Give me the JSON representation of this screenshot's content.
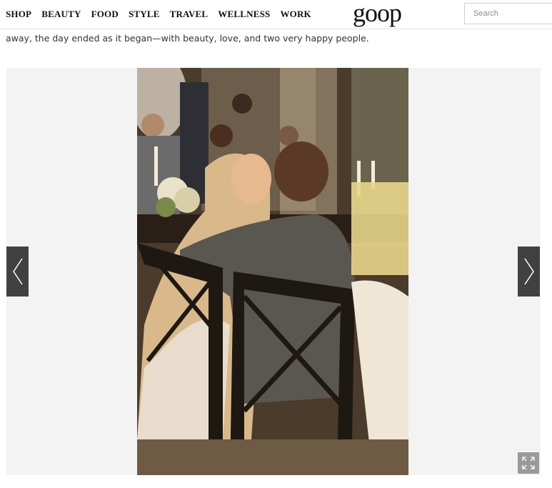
{
  "nav": {
    "items": [
      {
        "label": "SHOP"
      },
      {
        "label": "BEAUTY"
      },
      {
        "label": "FOOD"
      },
      {
        "label": "STYLE"
      },
      {
        "label": "TRAVEL"
      },
      {
        "label": "WELLNESS"
      },
      {
        "label": "WORK"
      }
    ],
    "logo": "goop",
    "search_placeholder": "Search"
  },
  "article": {
    "caption": "away, the day ended as it began—with beauty, love, and two very happy people."
  },
  "slideshow": {
    "prev_icon": "chevron-left-icon",
    "next_icon": "chevron-right-icon",
    "expand_icon": "expand-icon",
    "photo_subject": "wedding-couple-photo"
  },
  "colors": {
    "nav_text": "#111111",
    "arrow_bg": "#414141",
    "slideshow_bg": "#f3f3f3"
  }
}
